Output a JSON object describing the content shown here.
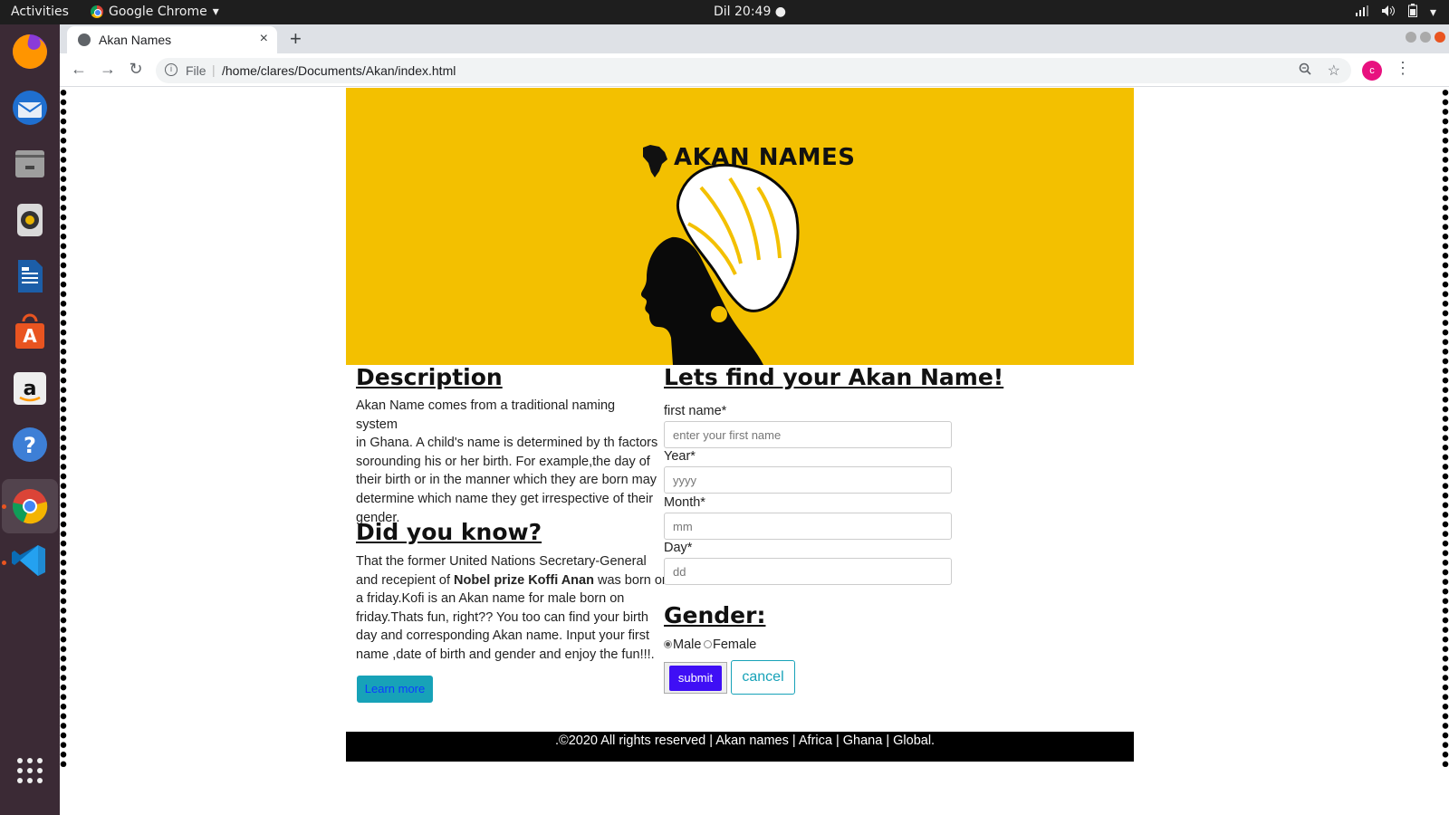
{
  "system": {
    "activities": "Activities",
    "app_name": "Google Chrome",
    "clock": "Dil 20:49 ●"
  },
  "browser": {
    "tab_title": "Akan Names",
    "new_tab": "+",
    "scheme": "File",
    "url": "/home/clares/Documents/Akan/index.html",
    "profile_initial": "c"
  },
  "hero": {
    "title": "AKAN NAMES",
    "background_color": "#f3c000"
  },
  "description": {
    "heading": "Description",
    "lines": [
      "Akan Name comes from a traditional naming system",
      "in Ghana. A child's name is determined by th factors",
      "sorounding his or her birth. For example,the day of",
      "their birth or in the manner which they are born may",
      "determine which name they get irrespective of their",
      "gender."
    ]
  },
  "did_you_know": {
    "heading": "Did you know?",
    "line1": "That the former United Nations Secretary-General",
    "line2_pre": "and recepient of ",
    "line2_bold": "Nobel prize Koffi Anan",
    "line2_post": " was born on",
    "lines_rest": [
      "a friday.Kofi is an Akan name for male born on",
      "friday.Thats fun, right?? You too can find your birth",
      "day and corresponding Akan name. Input your first",
      "name ,date of birth and gender and enjoy the fun!!!."
    ],
    "learn_more": "Learn more"
  },
  "form": {
    "heading": "Lets find your Akan Name!",
    "first_name_label": "first name*",
    "first_name_placeholder": "enter your first name",
    "year_label": "Year*",
    "year_placeholder": "yyyy",
    "month_label": "Month*",
    "month_placeholder": "mm",
    "day_label": "Day*",
    "day_placeholder": "dd",
    "gender_heading": "Gender:",
    "male_label": "Male",
    "female_label": "Female",
    "selected_gender": "Male",
    "submit_label": "submit",
    "cancel_label": "cancel"
  },
  "footer": {
    "text": ".©2020 All rights reserved | Akan names | Africa | Ghana | Global."
  },
  "dock": [
    "firefox-icon",
    "thunderbird-icon",
    "files-icon",
    "rhythmbox-icon",
    "writer-icon",
    "software-icon",
    "amazon-icon",
    "help-icon",
    "chrome-icon",
    "vscode-icon",
    "apps-grid-icon"
  ]
}
